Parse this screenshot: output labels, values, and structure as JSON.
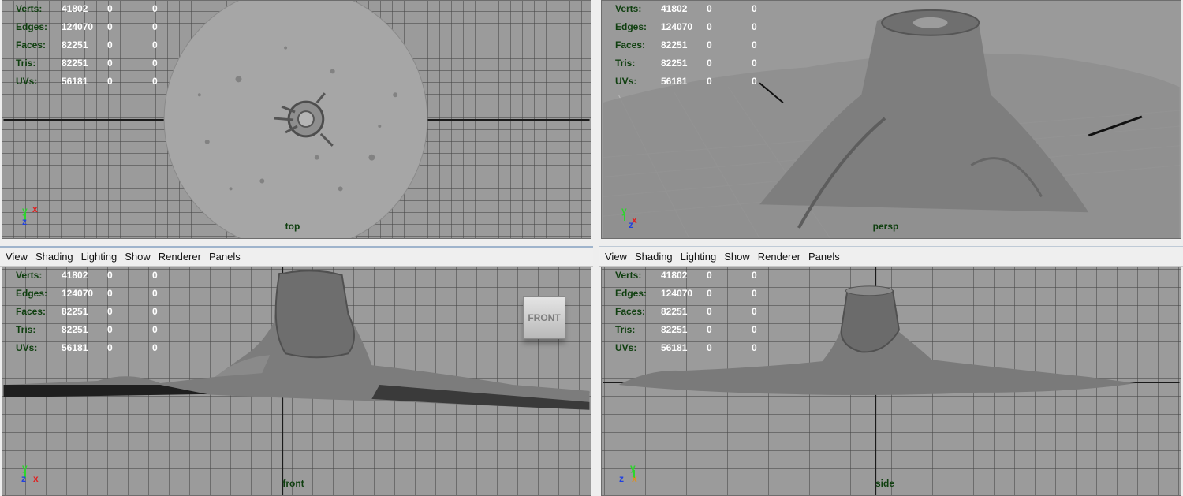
{
  "viewports": {
    "top": {
      "camera": "top"
    },
    "persp": {
      "camera": "persp"
    },
    "front": {
      "camera": "front",
      "viewcube": "FRONT"
    },
    "side": {
      "camera": "side"
    }
  },
  "menu": [
    "View",
    "Shading",
    "Lighting",
    "Show",
    "Renderer",
    "Panels"
  ],
  "hud": {
    "rows": [
      {
        "label": "Verts:",
        "v1": "41802",
        "v2": "0",
        "v3": "0"
      },
      {
        "label": "Edges:",
        "v1": "124070",
        "v2": "0",
        "v3": "0"
      },
      {
        "label": "Faces:",
        "v1": "82251",
        "v2": "0",
        "v3": "0"
      },
      {
        "label": "Tris:",
        "v1": "82251",
        "v2": "0",
        "v3": "0"
      },
      {
        "label": "UVs:",
        "v1": "56181",
        "v2": "0",
        "v3": "0"
      }
    ]
  },
  "axes": {
    "top": [
      "y",
      "x",
      "z"
    ],
    "persp": [
      "y",
      "x",
      "z"
    ],
    "front": [
      "y",
      "z",
      "x"
    ],
    "side": [
      "y",
      "z",
      "x"
    ]
  },
  "colors": {
    "hud_label": "#0f3f0f",
    "grid_bg": "#9b9b9b",
    "axis_x": "#e02020",
    "axis_y": "#2cd62c",
    "axis_z": "#2040e0"
  }
}
